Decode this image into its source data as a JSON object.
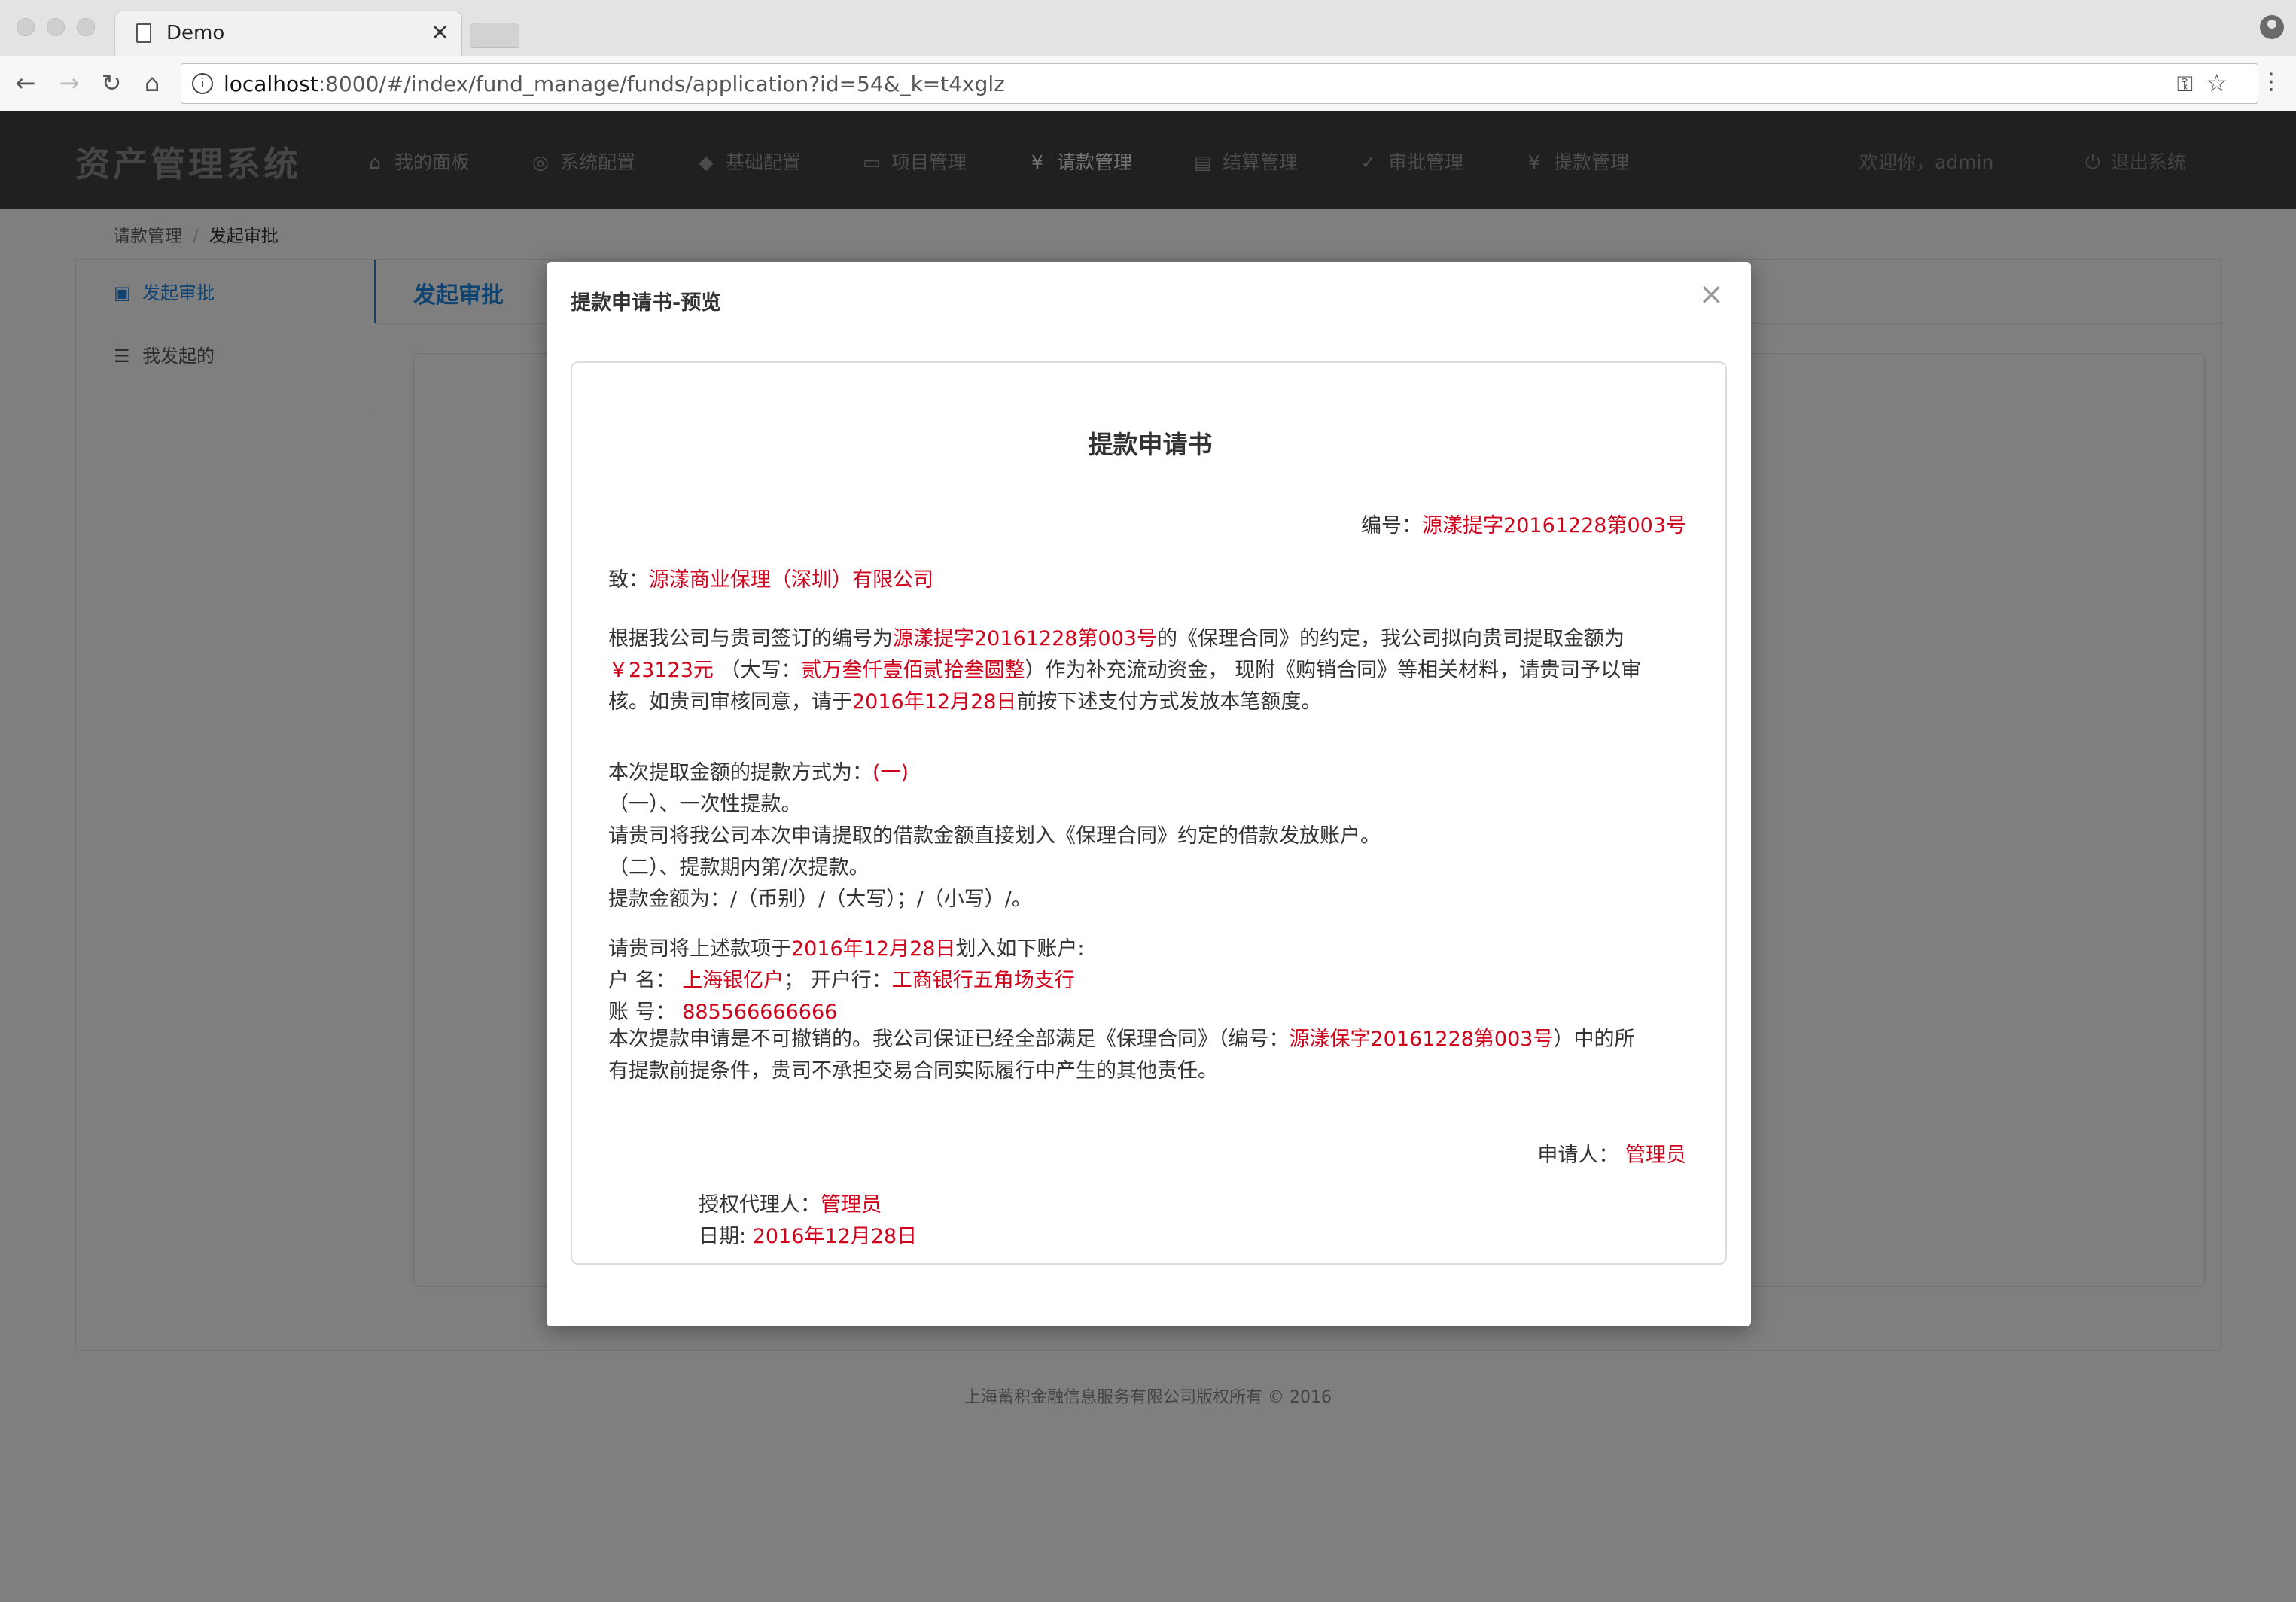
{
  "browser": {
    "tab_title": "Demo",
    "url_host": "localhost",
    "url_rest": ":8000/#/index/fund_manage/funds/application?id=54&_k=t4xglz"
  },
  "app": {
    "brand": "资产管理系统",
    "nav": [
      {
        "icon": "home-icon",
        "label": "我的面板"
      },
      {
        "icon": "target-icon",
        "label": "系统配置"
      },
      {
        "icon": "tag-icon",
        "label": "基础配置"
      },
      {
        "icon": "lock-icon",
        "label": "项目管理"
      },
      {
        "icon": "yen-icon",
        "label": "请款管理"
      },
      {
        "icon": "ledger-icon",
        "label": "结算管理"
      },
      {
        "icon": "check-circle-icon",
        "label": "审批管理"
      },
      {
        "icon": "yen-circle-icon",
        "label": "提款管理"
      }
    ],
    "welcome": "欢迎你，admin",
    "logout": "退出系统",
    "breadcrumb": [
      "请款管理",
      "发起审批"
    ],
    "sidebar": [
      {
        "icon": "inbox-icon",
        "label": "发起审批"
      },
      {
        "icon": "list-icon",
        "label": "我发起的"
      }
    ],
    "page_heading": "发起审批",
    "footer": "上海蓄积金融信息服务有限公司版权所有 © 2016"
  },
  "modal": {
    "title": "提款申请书-预览",
    "close": "×",
    "doc": {
      "title": "提款申请书",
      "number_label": "编号：",
      "number": "源漾提字20161228第003号",
      "to_label": "致：",
      "to": "源漾商业保理（深圳）有限公司",
      "p1_a": "根据我公司与贵司签订的编号为",
      "p1_contract_no": "源漾提字20161228第003号",
      "p1_b": "的《保理合同》的约定，我公司拟向贵司提取金额为",
      "p1_amount": "￥23123元",
      "p1_c": "（大写：",
      "p1_amount_cn": "贰万叁仟壹佰贰拾叁圆整",
      "p1_d": "）作为补充流动资金， 现附《购销合同》等相关材料，请贵司予以审",
      "p1_e": "核。如贵司审核同意，请于",
      "p1_date": "2016年12月28日",
      "p1_f": "前按下述支付方式发放本笔额度。",
      "p2_a": "本次提取金额的提款方式为：",
      "p2_mode": "(一)",
      "p2_line2": "（一）、一次性提款。",
      "p2_line3": "请贵司将我公司本次申请提取的借款金额直接划入《保理合同》约定的借款发放账户。",
      "p2_line4": "（二）、提款期内第/次提款。",
      "p2_line5": "提款金额为：/（币别）/（大写）；/（小写）/。",
      "p3_a": "请贵司将上述款项于",
      "p3_date": "2016年12月28日",
      "p3_b": "划入如下账户:",
      "acct_name_label": "户 名：",
      "acct_name": "上海银亿户",
      "acct_sep": "；",
      "bank_label": "开户行：",
      "bank": "工商银行五角场支行",
      "acct_no_label": "账 号：",
      "acct_no": "885566666666",
      "p4_a": "本次提款申请是不可撤销的。我公司保证已经全部满足《保理合同》（编号：",
      "p4_no": "源漾保字20161228第003号",
      "p4_b": "）中的所",
      "p4_c": "有提款前提条件，贵司不承担交易合同实际履行中产生的其他责任。",
      "applicant_label": "申请人：",
      "applicant": "管理员",
      "agent_label": "授权代理人：",
      "agent": "管理员",
      "date_label": "日期: ",
      "date": "2016年12月28日"
    }
  }
}
